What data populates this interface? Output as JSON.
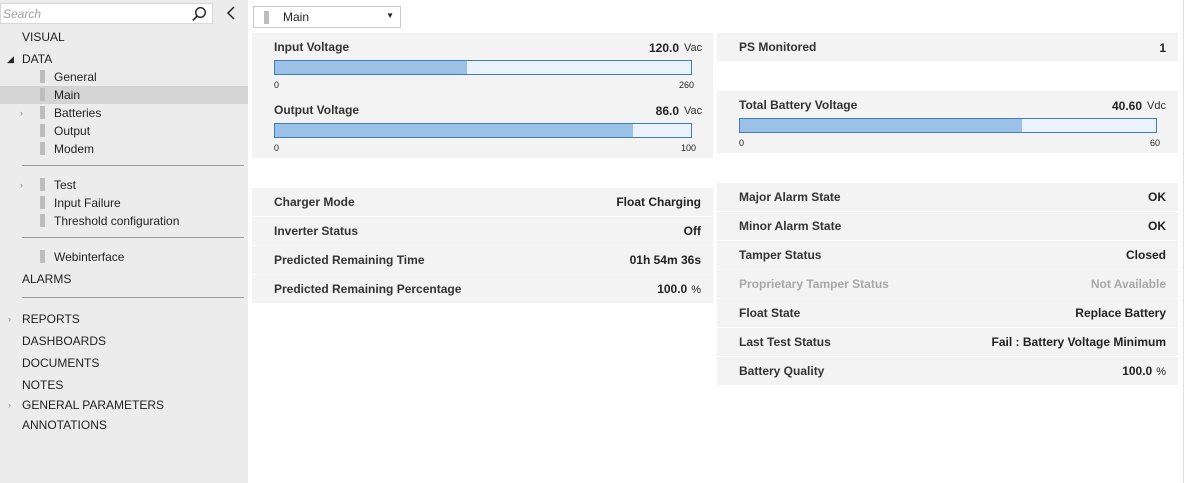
{
  "search": {
    "placeholder": "Search"
  },
  "sidebar": {
    "visual": "VISUAL",
    "data": "DATA",
    "data_items": {
      "general": "General",
      "main": "Main",
      "batteries": "Batteries",
      "output": "Output",
      "modem": "Modem",
      "test": "Test",
      "input_failure": "Input Failure",
      "threshold": "Threshold configuration",
      "webinterface": "Webinterface"
    },
    "alarms": "ALARMS",
    "reports": "REPORTS",
    "dashboards": "DASHBOARDS",
    "documents": "DOCUMENTS",
    "notes": "NOTES",
    "general_parameters": "GENERAL PARAMETERS",
    "annotations": "ANNOTATIONS"
  },
  "view_select": {
    "value": "Main"
  },
  "gauges": {
    "input_voltage": {
      "label": "Input Voltage",
      "value": "120.0",
      "unit": "Vac",
      "min": "0",
      "max": "260",
      "fraction": 0.4615
    },
    "output_voltage": {
      "label": "Output Voltage",
      "value": "86.0",
      "unit": "Vac",
      "min": "0",
      "max": "100",
      "fraction": 0.86
    },
    "total_battery_voltage": {
      "label": "Total Battery Voltage",
      "value": "40.60",
      "unit": "Vdc",
      "min": "0",
      "max": "60",
      "fraction": 0.6767
    }
  },
  "ps_monitored": {
    "label": "PS Monitored",
    "value": "1"
  },
  "left_rows": [
    {
      "label": "Charger Mode",
      "value": "Float Charging"
    },
    {
      "label": "Inverter Status",
      "value": "Off"
    },
    {
      "label": "Predicted Remaining Time",
      "value": "01h 54m 36s"
    },
    {
      "label": "Predicted Remaining Percentage",
      "value": "100.0",
      "unit": "%"
    }
  ],
  "right_rows": [
    {
      "label": "Major Alarm State",
      "value": "OK"
    },
    {
      "label": "Minor Alarm State",
      "value": "OK"
    },
    {
      "label": "Tamper Status",
      "value": "Closed"
    },
    {
      "label": "Proprietary Tamper Status",
      "value": "Not Available"
    },
    {
      "label": "Float State",
      "value": "Replace Battery"
    },
    {
      "label": "Last Test Status",
      "value": "Fail : Battery Voltage Minimum"
    },
    {
      "label": "Battery Quality",
      "value": "100.0",
      "unit": "%"
    }
  ]
}
